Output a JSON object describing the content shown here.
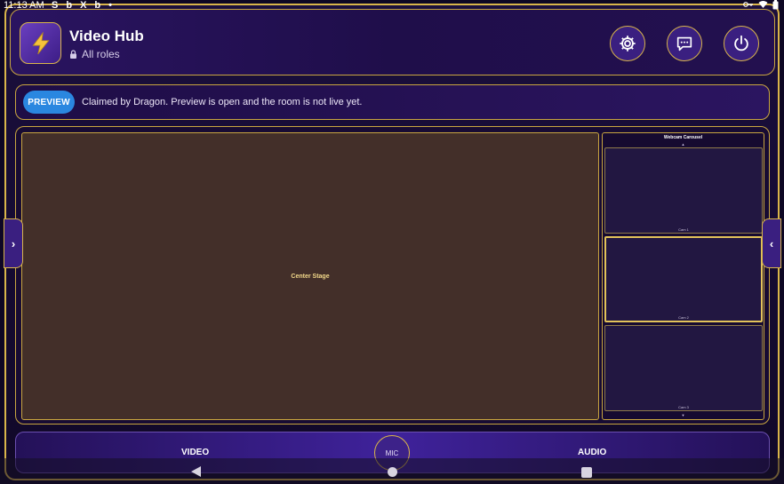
{
  "statusbar": {
    "time": "11:13 AM",
    "icons_left": [
      "S",
      "b",
      "X",
      "b",
      "•"
    ],
    "icons_right": [
      "key-icon",
      "wifi-icon",
      "battery-icon"
    ]
  },
  "header": {
    "title": "Video Hub",
    "subtitle": "All roles",
    "logo_icon": "lightning-icon",
    "buttons": [
      "settings-icon",
      "chat-icon",
      "power-icon"
    ]
  },
  "banner": {
    "pill": "PREVIEW",
    "message": "Claimed by Dragon. Preview is open and the room is not live yet."
  },
  "stage": {
    "label": "Center Stage"
  },
  "carousel": {
    "title": "Webcam Carousel",
    "up_arrow": "▲",
    "down_arrow": "▼",
    "cams": [
      {
        "label": "Cam 1",
        "active": false
      },
      {
        "label": "Cam 2",
        "active": true
      },
      {
        "label": "Cam 3",
        "active": false
      }
    ]
  },
  "sidetabs": {
    "left": "›",
    "right": "‹"
  },
  "bottombar": {
    "video": "VIDEO",
    "mic": "MIC",
    "audio": "AUDIO"
  },
  "colors": {
    "gold": "#d9b54a",
    "preview_blue": "#2a87e0",
    "stage_bg": "#432f29",
    "panel_bg": "#170b33"
  }
}
